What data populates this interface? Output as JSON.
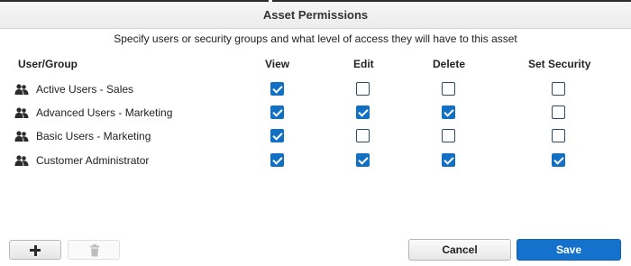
{
  "dialog": {
    "title": "Asset Permissions",
    "subtitle": "Specify users or security groups and what level of access they will have to this asset"
  },
  "columns": {
    "user_group": "User/Group",
    "view": "View",
    "edit": "Edit",
    "delete": "Delete",
    "set_security": "Set Security"
  },
  "rows": [
    {
      "name": "Active Users - Sales",
      "icon": "user-group-icon",
      "view": true,
      "edit": false,
      "delete": false,
      "set_security": false
    },
    {
      "name": "Advanced Users - Marketing",
      "icon": "user-group-icon",
      "view": true,
      "edit": true,
      "delete": true,
      "set_security": false
    },
    {
      "name": "Basic Users - Marketing",
      "icon": "user-group-icon",
      "view": true,
      "edit": false,
      "delete": false,
      "set_security": false
    },
    {
      "name": "Customer Administrator",
      "icon": "user-group-icon",
      "view": true,
      "edit": true,
      "delete": true,
      "set_security": true
    }
  ],
  "footer": {
    "add_icon": "plus-icon",
    "delete_icon": "trash-icon",
    "cancel_label": "Cancel",
    "save_label": "Save"
  },
  "colors": {
    "accent": "#1572cc",
    "checkbox_checked": "#1270c4",
    "checkbox_border": "#2a4b66"
  }
}
